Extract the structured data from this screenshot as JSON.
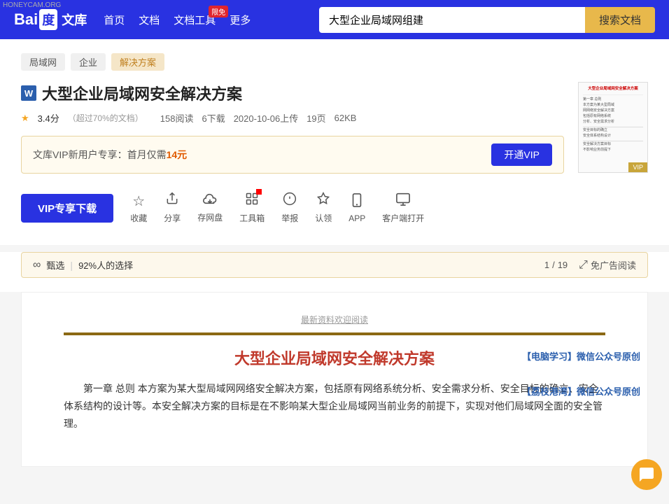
{
  "honeycam": "HONEYCAM.ORG",
  "navbar": {
    "logo_prefix": "Bai",
    "logo_box": "度",
    "logo_suffix": "文库",
    "nav_items": [
      {
        "label": "首页",
        "id": "home"
      },
      {
        "label": "文档",
        "id": "docs"
      },
      {
        "label": "文档工具",
        "id": "tools",
        "badge": "限免"
      },
      {
        "label": "更多",
        "id": "more"
      }
    ],
    "search_value": "大型企业局域网组建",
    "search_placeholder": "大型企业局域网组建",
    "search_btn": "搜索文档"
  },
  "breadcrumbs": [
    {
      "label": "局域网",
      "active": false
    },
    {
      "label": "企业",
      "active": false
    },
    {
      "label": "解决方案",
      "active": true
    }
  ],
  "document": {
    "title": "大型企业局域网安全解决方案",
    "word_label": "W",
    "rating": "3.4分",
    "rating_sub": "（超过70%的文档）",
    "reads": "158阅读",
    "downloads": "6下载",
    "upload_date": "2020-10-06上传",
    "pages": "19页",
    "size": "62KB"
  },
  "vip_banner": {
    "text": "文库VIP新用户专享：首月仅需",
    "price": "14元",
    "btn_label": "开通VIP"
  },
  "actions": [
    {
      "id": "vip-download",
      "label": "VIP专享下载",
      "is_btn": true
    },
    {
      "id": "collect",
      "label": "收藏",
      "icon": "☆"
    },
    {
      "id": "share",
      "label": "分享",
      "icon": "↗"
    },
    {
      "id": "cloud",
      "label": "存网盘",
      "icon": "☁"
    },
    {
      "id": "tools",
      "label": "工具箱",
      "icon": "⚙",
      "has_dot": true
    },
    {
      "id": "report",
      "label": "举报",
      "icon": "⚑"
    },
    {
      "id": "verify",
      "label": "认领",
      "icon": "✔"
    },
    {
      "id": "app",
      "label": "APP",
      "icon": "📱"
    },
    {
      "id": "client",
      "label": "客户端打开",
      "icon": "🖥"
    }
  ],
  "quality_bar": {
    "icon": "∞",
    "quality_label": "甄选",
    "divider": "|",
    "percent_text": "92%人的选择",
    "page_current": "1",
    "page_sep": "/",
    "page_total": "19",
    "ad_free_label": "免广告阅读",
    "expand_icon": "⤢"
  },
  "preview": {
    "watermark_top": "最新资料欢迎阅读",
    "main_title": "大型企业局域网安全解决方案",
    "body_text": "第一章  总则  本方案为某大型局域网网络安全解决方案，包括原有网络系统分析、安全需求分析、安全目标的确立、安全体系结构的设计等。本安全解决方案的目标是在不影响某大型企业局域网当前业务的前提下，实现对他们局域网全面的安全管理。",
    "watermark1": "【电脑学习】微信公众号原创",
    "watermark2": "【荔枝港湾】微信公众号原创"
  },
  "thumbnail": {
    "title": "大型企业局域网安全解决方案",
    "lines": [
      "第一章 总则",
      "本方案为某大型局域",
      "网网络安全解决方案",
      "包括原有网络系统",
      "分析、安全需求分析"
    ],
    "vip_label": "VIP"
  }
}
